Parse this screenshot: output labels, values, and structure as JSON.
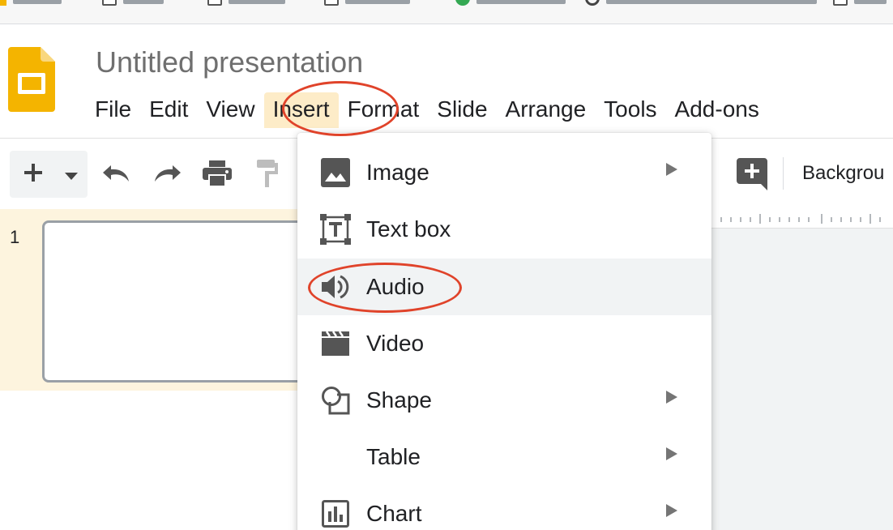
{
  "document": {
    "title": "Untitled presentation"
  },
  "menubar": [
    "File",
    "Edit",
    "View",
    "Insert",
    "Format",
    "Slide",
    "Arrange",
    "Tools",
    "Add-ons"
  ],
  "active_menu": "Insert",
  "toolbar": {
    "background_label": "Backgrou"
  },
  "filmstrip": {
    "slide_number": "1"
  },
  "insert_menu": {
    "items": [
      {
        "label": "Image",
        "icon": "image-icon",
        "has_submenu": true
      },
      {
        "label": "Text box",
        "icon": "text-box-icon",
        "has_submenu": false
      },
      {
        "label": "Audio",
        "icon": "audio-icon",
        "has_submenu": false,
        "highlighted": true
      },
      {
        "label": "Video",
        "icon": "video-icon",
        "has_submenu": false
      },
      {
        "label": "Shape",
        "icon": "shape-icon",
        "has_submenu": true
      },
      {
        "label": "Table",
        "icon": "",
        "has_submenu": true
      },
      {
        "label": "Chart",
        "icon": "chart-icon",
        "has_submenu": true
      }
    ]
  },
  "annotations": {
    "color": "#e0432a",
    "circled": [
      "Insert",
      "Audio"
    ]
  },
  "colors": {
    "active_menu_bg": "#fdecc8",
    "hover_bg": "#f1f3f4",
    "slides_yellow": "#f4b400"
  }
}
